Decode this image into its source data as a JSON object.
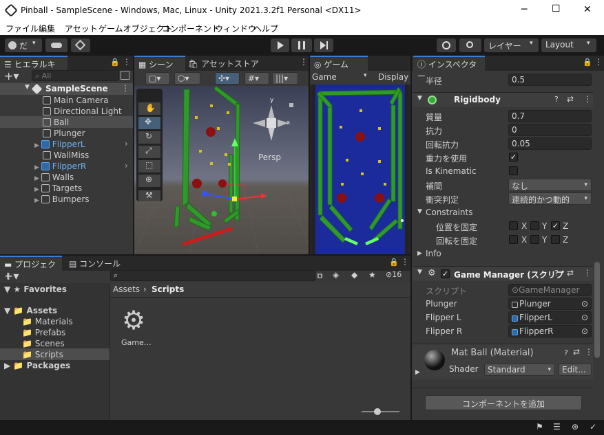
{
  "window": {
    "title": "Pinball - SampleScene - Windows, Mac, Linux - Unity 2021.3.2f1 Personal <DX11>",
    "minimize": "─",
    "maximize": "☐",
    "close": "✕"
  },
  "menu": [
    "ファイル",
    "編集",
    "アセット",
    "ゲームオブジェクト",
    "コンポーネント",
    "ウィンドウ",
    "ヘルプ"
  ],
  "toolbar": {
    "account": "だ",
    "layers": "レイヤー",
    "layout": "Layout"
  },
  "hierarchy": {
    "tab": "ヒエラルキー",
    "search_placeholder": "All",
    "scene": "SampleScene",
    "items": [
      "Main Camera",
      "Directional Light",
      "Ball",
      "Plunger",
      "FlipperL",
      "WallMiss",
      "FlipperR",
      "Walls",
      "Targets",
      "Bumpers"
    ]
  },
  "scene": {
    "tab": "シーン",
    "asset_store_tab": "アセットストア",
    "persp": "Persp",
    "gizmo_y": "y",
    "gizmo_x": "x"
  },
  "game": {
    "tab": "ゲーム",
    "display": "Game",
    "display_select": "Display"
  },
  "inspector": {
    "tab": "インスペクター",
    "radius_label": "半径",
    "radius_value": "0.5",
    "rigidbody": {
      "title": "Rigidbody",
      "mass_label": "質量",
      "mass": "0.7",
      "drag_label": "抗力",
      "drag": "0",
      "angular_label": "回転抗力",
      "angular": "0.05",
      "gravity_label": "重力を使用",
      "kinematic_label": "Is Kinematic",
      "interp_label": "補間",
      "interp": "なし",
      "collision_label": "衝突判定",
      "collision": "連続的かつ動的",
      "constraints_label": "Constraints",
      "freeze_pos": "位置を固定",
      "freeze_rot": "回転を固定",
      "x": "X",
      "y": "Y",
      "z": "Z",
      "info": "Info"
    },
    "gm": {
      "title": "Game Manager (スクリプ",
      "script_label": "スクリプト",
      "script": "GameManager",
      "plunger_label": "Plunger",
      "plunger": "Plunger",
      "fl_label": "Flipper L",
      "fl": "FlipperL",
      "fr_label": "Flipper R",
      "fr": "FlipperR"
    },
    "mat": {
      "title": "Mat Ball (Material)",
      "shader_label": "Shader",
      "shader": "Standard",
      "edit": "Edit..."
    },
    "add_component": "コンポーネントを追加"
  },
  "project": {
    "tab": "プロジェクト",
    "console_tab": "コンソール",
    "favorites": "Favorites",
    "assets": "Assets",
    "folders": [
      "Materials",
      "Prefabs",
      "Scenes",
      "Scripts"
    ],
    "packages": "Packages",
    "breadcrumb_root": "Assets",
    "breadcrumb_leaf": "Scripts",
    "file": "Game…",
    "hidden_count": "16"
  },
  "icons": [
    "unity-logo-icon",
    "account-icon",
    "cloud-icon",
    "collab-icon",
    "play-icon",
    "pause-icon",
    "step-icon",
    "history-icon",
    "search-icon",
    "kebab-icon",
    "gear-icon"
  ]
}
